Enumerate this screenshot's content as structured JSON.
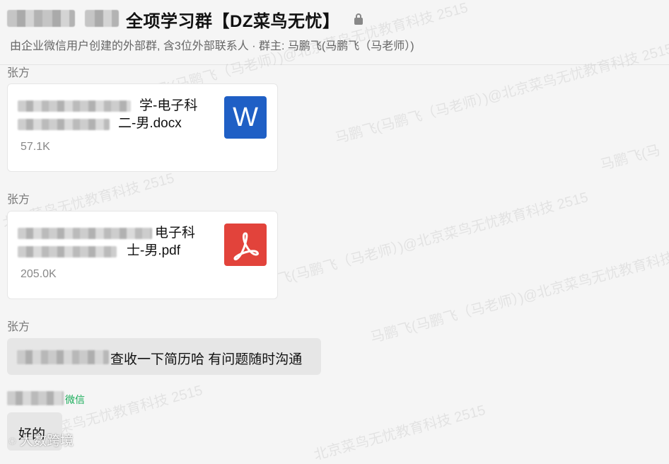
{
  "header": {
    "title": "全项学习群【DZ菜鸟无忧】",
    "subtitle": "由企业微信用户创建的外部群, 含3位外部联系人 · 群主: 马鹏飞(马鹏飞（马老师）)"
  },
  "messages": [
    {
      "sender": "张方",
      "file": {
        "name_line1": "学-电子科",
        "name_line2": "二-男.docx",
        "size": "57.1K",
        "icon_letter": "W",
        "icon": "word-doc-icon"
      }
    },
    {
      "sender": "张方",
      "file": {
        "name_line1": "电子科",
        "name_line2": "士-男.pdf",
        "size": "205.0K",
        "icon": "pdf-icon"
      }
    },
    {
      "sender": "张方",
      "text": "查收一下简历哈 有问题随时沟通"
    },
    {
      "tag": "微信",
      "text": "好的"
    }
  ],
  "watermarks": [
    "马鹏飞(马鹏飞（马老师）)@北京菜鸟无忧教育科技 2515",
    "马鹏飞(马",
    "北京菜鸟无忧教育科技 2515"
  ],
  "corner_watermark": "大数跨境",
  "colors": {
    "word": "#1f5fc5",
    "pdf": "#e2433b",
    "wechat_tag": "#1aad5a"
  }
}
